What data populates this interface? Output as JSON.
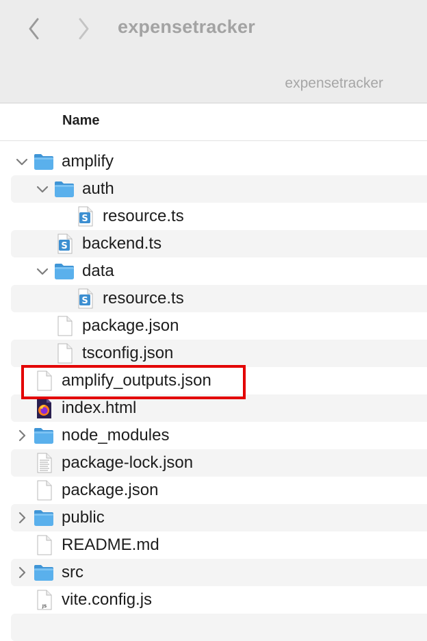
{
  "window": {
    "title": "expensetracker",
    "path_label": "expensetracker",
    "back_icon": "chevron-left-icon",
    "forward_icon": "chevron-right-icon"
  },
  "columns": {
    "name": "Name"
  },
  "accent": {
    "folder": "#5ab0ec",
    "highlight": "#e30000"
  },
  "files": [
    {
      "name": "amplify",
      "kind": "folder",
      "depth": 0,
      "expanded": true
    },
    {
      "name": "auth",
      "kind": "folder",
      "depth": 1,
      "expanded": true
    },
    {
      "name": "resource.ts",
      "kind": "typescript",
      "depth": 2
    },
    {
      "name": "backend.ts",
      "kind": "typescript",
      "depth": 1
    },
    {
      "name": "data",
      "kind": "folder",
      "depth": 1,
      "expanded": true
    },
    {
      "name": "resource.ts",
      "kind": "typescript",
      "depth": 2
    },
    {
      "name": "package.json",
      "kind": "file",
      "depth": 1
    },
    {
      "name": "tsconfig.json",
      "kind": "file",
      "depth": 1
    },
    {
      "name": "amplify_outputs.json",
      "kind": "file",
      "depth": 0,
      "highlighted": true
    },
    {
      "name": "index.html",
      "kind": "html",
      "depth": 0
    },
    {
      "name": "node_modules",
      "kind": "folder",
      "depth": 0,
      "expanded": false
    },
    {
      "name": "package-lock.json",
      "kind": "text",
      "depth": 0
    },
    {
      "name": "package.json",
      "kind": "file",
      "depth": 0
    },
    {
      "name": "public",
      "kind": "folder",
      "depth": 0,
      "expanded": false
    },
    {
      "name": "README.md",
      "kind": "file",
      "depth": 0
    },
    {
      "name": "src",
      "kind": "folder",
      "depth": 0,
      "expanded": false
    },
    {
      "name": "vite.config.js",
      "kind": "js",
      "depth": 0
    }
  ]
}
